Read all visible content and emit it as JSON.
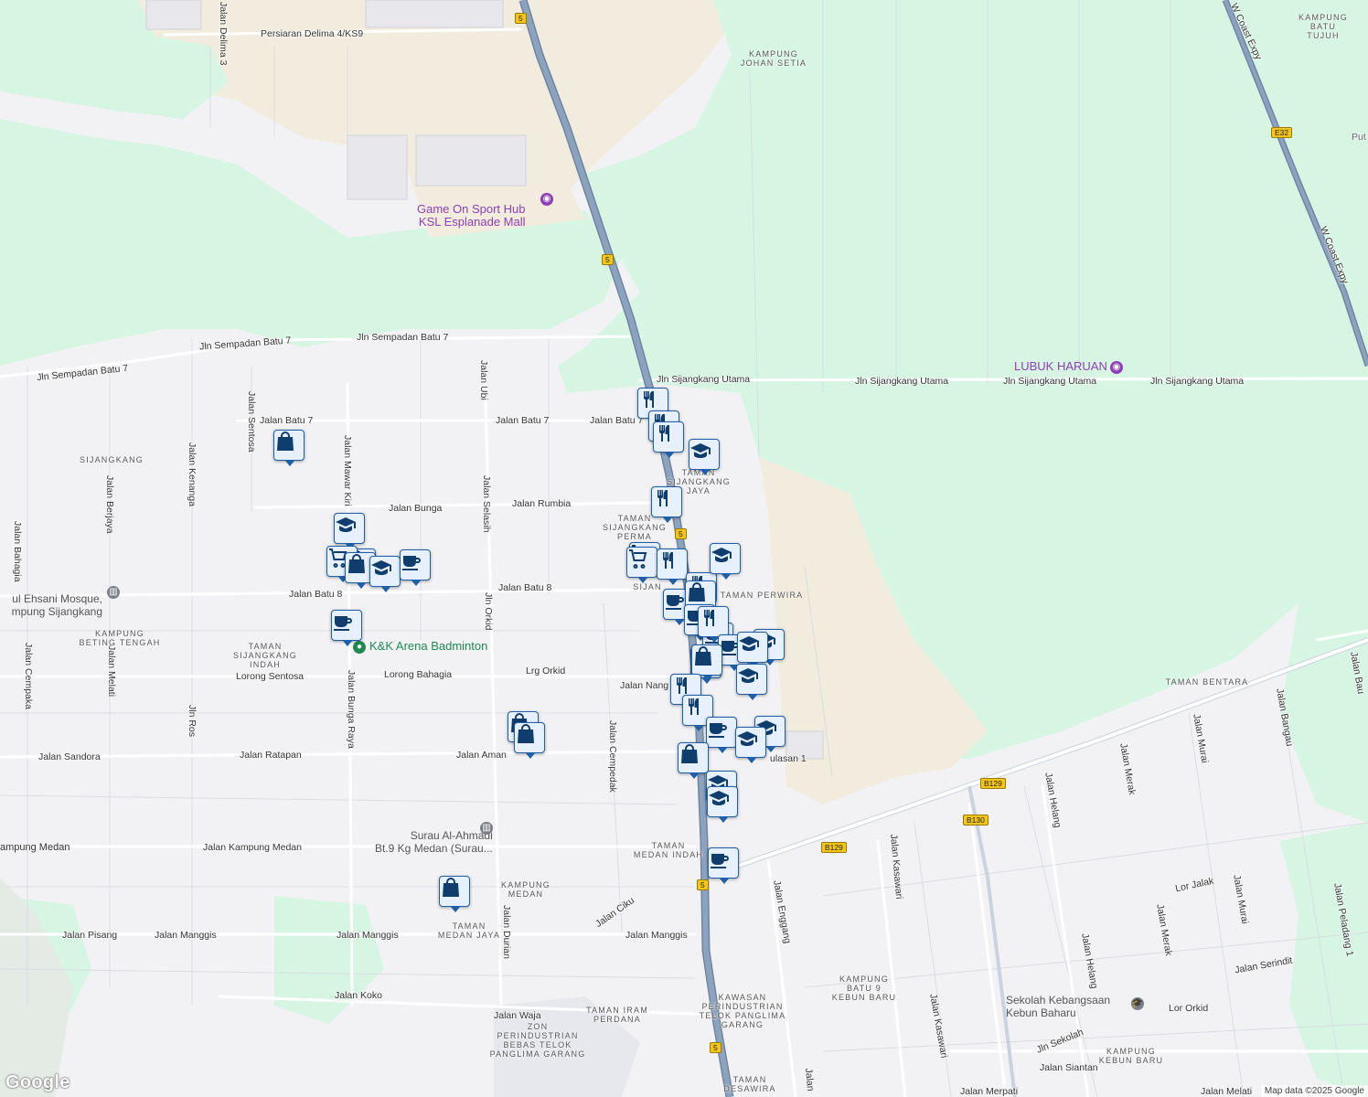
{
  "map": {
    "attribution": "Map data ©2025 Google",
    "logo": "Google",
    "colors": {
      "land": "#f2f2f4",
      "green": "#d6f5e3",
      "sand": "#f1ecdd",
      "road": "#ffffff",
      "minor_road": "#d9dde3",
      "highway": "#8da3bd",
      "pin_fill": "#e6f0ff",
      "pin_border": "#1f5fa8",
      "pin_icon": "#0f3d6e"
    },
    "road_labels": [
      "Persiaran Delima 4/KS9",
      "Jln Sempadan Batu 7",
      "Jln Sempadan Batu 7",
      "Jln Sijangkang Utama",
      "Jln Sijangkang Utama",
      "Jln Sijangkang Utama",
      "Jln Sijangkang Utama",
      "Jalan Batu 7",
      "Jalan Batu 7",
      "Jalan Batu 7",
      "Jalan Bunga",
      "Jalan Rumbia",
      "Jalan Batu 8",
      "Jalan Batu 8",
      "Lorong Sentosa",
      "Lorong Bahagia",
      "Lrg Orkid",
      "Jalan Nang",
      "Jalan Sandora",
      "Jalan Ratapan",
      "Jalan Aman",
      "Jalan Kampung Medan",
      "Jalan Pisang",
      "Jalan Manggis",
      "Jalan Manggis",
      "Jalan Manggis",
      "Jalan Koko",
      "Jalan Waja",
      "Jalan Ciku",
      "Lor Jalak",
      "Jalan Serindit",
      "Lor Orkid",
      "Jln Sekolah",
      "Jalan Siantan",
      "Jalan Merpati",
      "Jalan Melati",
      "Jalan Bahagia",
      "Jalan Berjaya",
      "Jalan Kenanga",
      "Jalan Sentosa",
      "Jalan Mawar Kiri",
      "Jalan Ubi",
      "Jalan Selasih",
      "Jln Orkid",
      "Jalan Cempaka",
      "Jalan Melati",
      "Jln Ros",
      "Jalan Bunga Raya",
      "Jalan Cempedak",
      "Jalan Durian",
      "Jalan Enggang",
      "Jalan Kasawari",
      "Jalan Kasawari",
      "Jalan Helang",
      "Jalan Helang",
      "Jalan Merak",
      "Jalan Merak",
      "Jalan Murai",
      "Jalan Murai",
      "Jalan Bangau",
      "Jalan Peladang 1",
      "Jalan Bau",
      "W Coast Expy",
      "W Coast Expy",
      "Jalan",
      "Jalan Delima 3",
      "ulasan 1"
    ],
    "area_labels": [
      "KAMPUNG\nBATU TUJUH",
      "KAMPUNG\nJOHAN SETIA",
      "SIJANGKANG",
      "TAMAN\nSIJANGKANG\nJAYA",
      "TAMAN\nSIJANGKANG\nPERMA",
      "TAMAN PERWIRA",
      "SIJAN",
      "KAMPUNG\nBETING TENGAH",
      "TAMAN\nSIJANGKANG\nINDAH",
      "TAMAN BENTARA",
      "TAMAN\nMEDAN INDAH",
      "KAMPUNG\nMEDAN",
      "TAMAN\nMEDAN JAYA",
      "TAMAN IRAM\nPERDANA",
      "ZON\nPERINDUSTRIAN\nBEBAS TELOK\nPANGLIMA GARANG",
      "KAWASAN\nPERINDUSTRIAN\nTELOK PANGLIMA\nGARANG",
      "KAMPUNG\nBATU 9\nKEBUN BARU",
      "KAMPUNG\nKEBUN BARU",
      "TAMAN\nDESAWIRA",
      "Put"
    ],
    "places": [
      {
        "name": "Game On Sport Hub\nKSL Esplanade Mall",
        "icon": "camera-icon",
        "color": "purple"
      },
      {
        "name": "LUBUK HARUAN",
        "icon": "camera-icon",
        "color": "purple"
      },
      {
        "name": "K&K Arena Badminton",
        "icon": "location-icon",
        "color": "green"
      },
      {
        "name": "ul Ehsani Mosque,\nmpung Sijangkang",
        "icon": "mosque-icon",
        "color": "gray"
      },
      {
        "name": "Surau Al-Ahmadi\nBt.9 Kg Medan (Surau...",
        "icon": "mosque-icon",
        "color": "gray"
      },
      {
        "name": "Sekolah Kebangsaan Kebun Baharu",
        "icon": "school-icon",
        "color": "gray"
      },
      {
        "name": "ampung Medan",
        "icon": "",
        "color": "gray"
      }
    ],
    "route_shields": [
      "5",
      "5",
      "5",
      "5",
      "5",
      "E32",
      "B129",
      "B129",
      "B130"
    ],
    "pins": [
      {
        "type": "restaurant"
      },
      {
        "type": "restaurant"
      },
      {
        "type": "restaurant"
      },
      {
        "type": "school"
      },
      {
        "type": "restaurant"
      },
      {
        "type": "shopping"
      },
      {
        "type": "school"
      },
      {
        "type": "shopping"
      },
      {
        "type": "grocery"
      },
      {
        "type": "shopping"
      },
      {
        "type": "school"
      },
      {
        "type": "cafe"
      },
      {
        "type": "cafe"
      },
      {
        "type": "grocery"
      },
      {
        "type": "grocery"
      },
      {
        "type": "restaurant"
      },
      {
        "type": "restaurant"
      },
      {
        "type": "school"
      },
      {
        "type": "shopping"
      },
      {
        "type": "cafe"
      },
      {
        "type": "cafe"
      },
      {
        "type": "restaurant"
      },
      {
        "type": "cafe"
      },
      {
        "type": "school"
      },
      {
        "type": "school"
      },
      {
        "type": "cafe"
      },
      {
        "type": "shopping"
      },
      {
        "type": "school"
      },
      {
        "type": "restaurant"
      },
      {
        "type": "restaurant"
      },
      {
        "type": "shopping"
      },
      {
        "type": "shopping"
      },
      {
        "type": "cafe"
      },
      {
        "type": "school"
      },
      {
        "type": "school"
      },
      {
        "type": "shopping"
      },
      {
        "type": "school"
      },
      {
        "type": "school"
      },
      {
        "type": "cafe"
      },
      {
        "type": "shopping"
      },
      {
        "type": "cafe"
      }
    ]
  }
}
